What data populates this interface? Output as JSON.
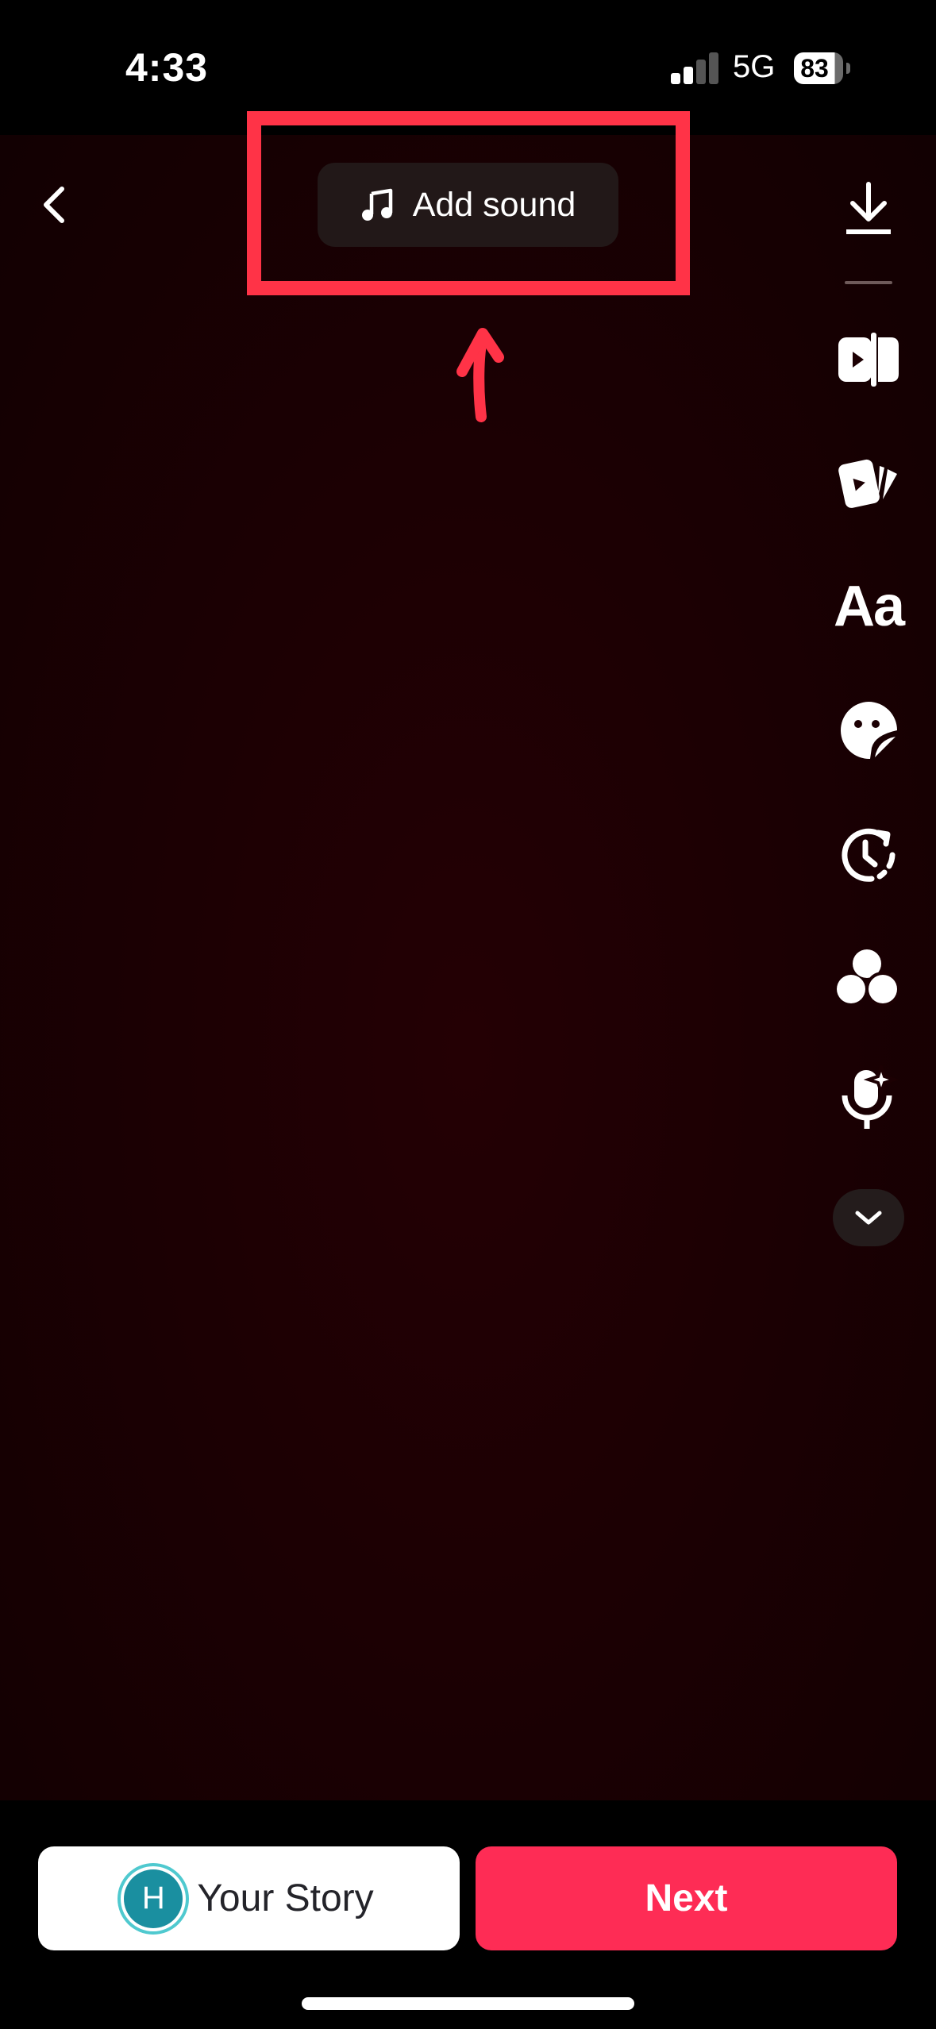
{
  "status_bar": {
    "time": "4:33",
    "network": "5G",
    "battery_percent": "83",
    "signal_bars_active": 2,
    "signal_bars_total": 4
  },
  "top": {
    "back_icon": "chevron-left-icon",
    "add_sound_label": "Add sound",
    "add_sound_icon": "music-note-icon"
  },
  "annotation": {
    "color": "#ff3347",
    "highlight_target": "add-sound-button",
    "arrow_direction": "up"
  },
  "toolbar": {
    "items": [
      {
        "name": "download",
        "icon": "download-icon"
      },
      {
        "name": "edit",
        "icon": "video-edit-icon"
      },
      {
        "name": "templates",
        "icon": "templates-icon"
      },
      {
        "name": "text",
        "icon": "text-icon",
        "label": "Aa"
      },
      {
        "name": "stickers",
        "icon": "sticker-icon"
      },
      {
        "name": "effects",
        "icon": "timer-effects-icon"
      },
      {
        "name": "filters",
        "icon": "filters-icon"
      },
      {
        "name": "voice",
        "icon": "ai-voice-mic-icon"
      },
      {
        "name": "more",
        "icon": "chevron-down-icon"
      }
    ]
  },
  "bottom": {
    "story_avatar_initial": "H",
    "story_label": "Your Story",
    "next_label": "Next"
  },
  "colors": {
    "accent": "#fe2c55",
    "avatar": "#1a8fa0",
    "avatar_ring": "#4fc9cf",
    "canvas": "#1c0003"
  }
}
